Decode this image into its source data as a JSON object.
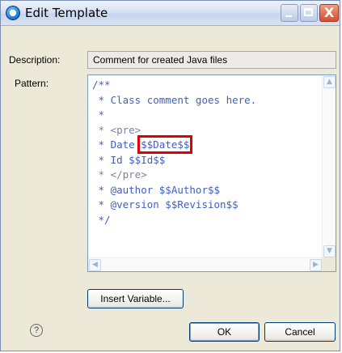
{
  "window": {
    "title": "Edit Template"
  },
  "form": {
    "description_label": "Description:",
    "description_value": "Comment for created Java files",
    "pattern_label": "Pattern:"
  },
  "pattern_lines": [
    "/**",
    " * Class comment goes here.",
    " *",
    " * <pre>",
    " * Date ",
    "$$Date$$",
    " * Id $$Id$$",
    " * </pre>",
    " * @author $$Author$$",
    " * @version $$Revision$$",
    " */"
  ],
  "buttons": {
    "insert_variable": "Insert Variable...",
    "ok": "OK",
    "cancel": "Cancel"
  },
  "icons": {
    "help": "?",
    "close": "X"
  },
  "colors": {
    "highlight": "#e00000",
    "code": "#3f5fbf"
  }
}
